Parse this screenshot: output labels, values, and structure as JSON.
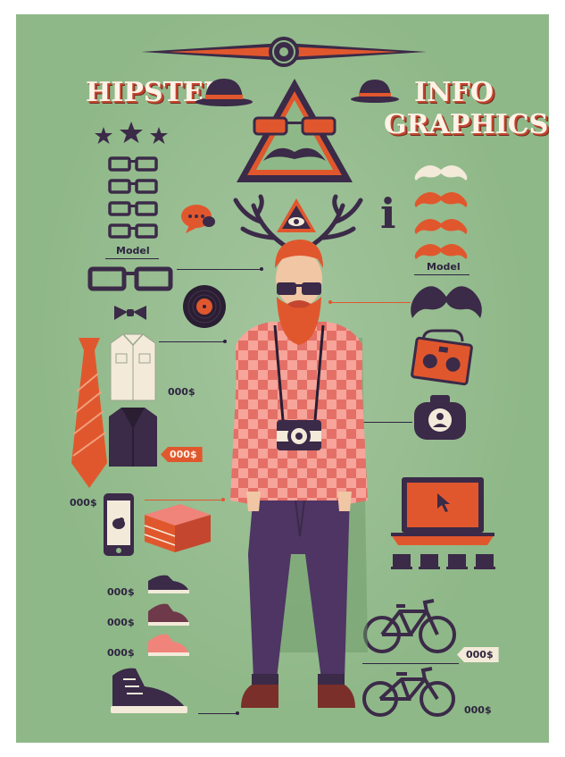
{
  "title": {
    "line1": "HIPSTER",
    "line2": "INFO",
    "line3": "GRAPHICS"
  },
  "labels": {
    "glasses_model": "Model",
    "mustache_model": "Model",
    "info_glyph": "i"
  },
  "prices": {
    "shirt": "000$",
    "jacket_tag": "000$",
    "phone": "000$",
    "sneaker_1": "000$",
    "sneaker_2": "000$",
    "sneaker_3": "000$",
    "bike_1_tag": "000$",
    "bike_2": "000$"
  },
  "colors": {
    "background": "#8fb888",
    "orange": "#e1572d",
    "dark_purple": "#3b2a48",
    "cream": "#f3ead9",
    "pink_check": "#f0837a"
  }
}
